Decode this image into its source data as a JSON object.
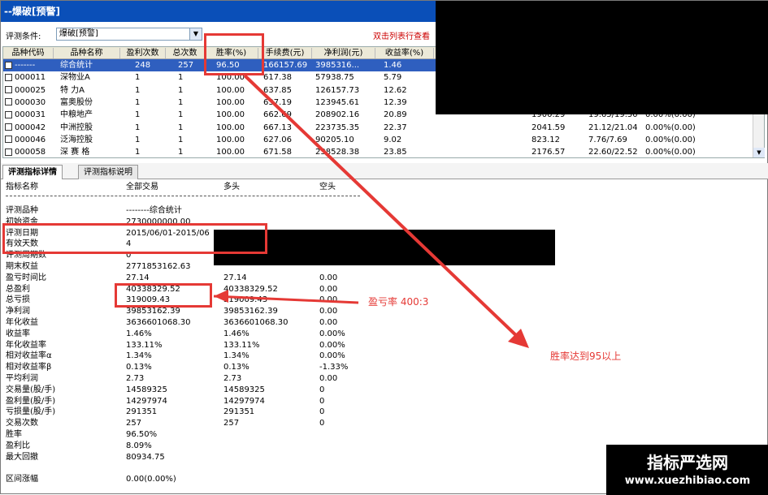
{
  "window_title": "--爆破[预警]",
  "filter": {
    "label": "评测条件:",
    "value": "爆破[预警]",
    "hint": "双击列表行查看"
  },
  "grid": {
    "columns": [
      "品种代码",
      "品种名称",
      "盈利次数",
      "总次数",
      "胜率(%)",
      "手续费(元)",
      "净利润(元)",
      "收益率(%)"
    ],
    "rows": [
      {
        "code": "-------",
        "name": "综合统计",
        "wins": "248",
        "total": "257",
        "rate": "96.50",
        "fee": "166157.69",
        "profit": "3985316...",
        "ret": "1.46",
        "extra1": "",
        "extra2": "",
        "extra3": ""
      },
      {
        "code": "000011",
        "name": "深物业A",
        "wins": "1",
        "total": "1",
        "rate": "100.00",
        "fee": "617.38",
        "profit": "57938.75",
        "ret": "5.79",
        "extra1": "",
        "extra2": "",
        "extra3": ""
      },
      {
        "code": "000025",
        "name": "特  力A",
        "wins": "1",
        "total": "1",
        "rate": "100.00",
        "fee": "637.85",
        "profit": "126157.73",
        "ret": "12.62",
        "extra1": "",
        "extra2": "",
        "extra3": ""
      },
      {
        "code": "000030",
        "name": "富奥股份",
        "wins": "1",
        "total": "1",
        "rate": "100.00",
        "fee": "637.19",
        "profit": "123945.61",
        "ret": "12.39",
        "extra1": "",
        "extra2": "",
        "extra3": ""
      },
      {
        "code": "000031",
        "name": "中粮地产",
        "wins": "1",
        "total": "1",
        "rate": "100.00",
        "fee": "662.69",
        "profit": "208902.16",
        "ret": "20.89",
        "extra1": "1900.29",
        "extra2": "19.65/19.50",
        "extra3": "0.00%(0.00)"
      },
      {
        "code": "000042",
        "name": "中洲控股",
        "wins": "1",
        "total": "1",
        "rate": "100.00",
        "fee": "667.13",
        "profit": "223735.35",
        "ret": "22.37",
        "extra1": "2041.59",
        "extra2": "21.12/21.04",
        "extra3": "0.00%(0.00)"
      },
      {
        "code": "000046",
        "name": "泛海控股",
        "wins": "1",
        "total": "1",
        "rate": "100.00",
        "fee": "627.06",
        "profit": "90205.10",
        "ret": "9.02",
        "extra1": "823.12",
        "extra2": "7.76/7.69",
        "extra3": "0.00%(0.00)"
      },
      {
        "code": "000058",
        "name": "深 赛 格",
        "wins": "1",
        "total": "1",
        "rate": "100.00",
        "fee": "671.58",
        "profit": "238528.38",
        "ret": "23.85",
        "extra1": "2176.57",
        "extra2": "22.60/22.52",
        "extra3": "0.00%(0.00)"
      }
    ]
  },
  "tabs": [
    "评测指标详情",
    "评测指标说明"
  ],
  "panel": {
    "headers": [
      "指标名称",
      "全部交易",
      "多头",
      "空头"
    ],
    "rows": [
      {
        "name": "评测品种",
        "all": "--------综合统计",
        "long": "",
        "short": ""
      },
      {
        "name": "初始资金",
        "all": "2730000000.00",
        "long": "",
        "short": ""
      },
      {
        "name": "评测日期",
        "all": "2015/06/01-2015/06",
        "long": "",
        "short": ""
      },
      {
        "name": "有效天数",
        "all": "4",
        "long": "",
        "short": ""
      },
      {
        "name": "评测周期数",
        "all": "0",
        "long": "",
        "short": ""
      },
      {
        "name": "期末权益",
        "all": "2771853162.63",
        "long": "",
        "short": ""
      },
      {
        "name": "盈亏时间比",
        "all": "27.14",
        "long": "27.14",
        "short": "0.00"
      },
      {
        "name": "总盈利",
        "all": "40338329.52",
        "long": "40338329.52",
        "short": "0.00"
      },
      {
        "name": "总亏损",
        "all": "319009.43",
        "long": "319009.43",
        "short": "0.00"
      },
      {
        "name": "净利润",
        "all": "39853162.39",
        "long": "39853162.39",
        "short": "0.00"
      },
      {
        "name": "年化收益",
        "all": "3636601068.30",
        "long": "3636601068.30",
        "short": "0.00"
      },
      {
        "name": "收益率",
        "all": "1.46%",
        "long": "1.46%",
        "short": "0.00%"
      },
      {
        "name": "年化收益率",
        "all": "133.11%",
        "long": "133.11%",
        "short": "0.00%"
      },
      {
        "name": "相对收益率α",
        "all": "1.34%",
        "long": "1.34%",
        "short": "0.00%"
      },
      {
        "name": "相对收益率β",
        "all": "0.13%",
        "long": "0.13%",
        "short": "-1.33%"
      },
      {
        "name": "平均利润",
        "all": "2.73",
        "long": "2.73",
        "short": "0.00"
      },
      {
        "name": "交易量(股/手)",
        "all": "14589325",
        "long": "14589325",
        "short": "0"
      },
      {
        "name": "盈利量(股/手)",
        "all": "14297974",
        "long": "14297974",
        "short": "0"
      },
      {
        "name": "亏损量(股/手)",
        "all": "291351",
        "long": "291351",
        "short": "0"
      },
      {
        "name": "交易次数",
        "all": "257",
        "long": "257",
        "short": "0"
      },
      {
        "name": "胜率",
        "all": "96.50%",
        "long": "",
        "short": ""
      },
      {
        "name": "盈利比",
        "all": "8.09%",
        "long": "",
        "short": ""
      },
      {
        "name": "最大回撤",
        "all": "80934.75",
        "long": "",
        "short": ""
      },
      {
        "name": "",
        "all": "",
        "long": "",
        "short": ""
      },
      {
        "name": "区间涨幅",
        "all": "0.00(0.00%)",
        "long": "",
        "short": ""
      }
    ]
  },
  "annotations": {
    "ratio": "盈亏率 400:3",
    "winrate": "胜率达到95以上",
    "accent": "#e53935"
  },
  "watermark": {
    "line1": "指标严选网",
    "line2": "www.xuezhibiao.com"
  }
}
